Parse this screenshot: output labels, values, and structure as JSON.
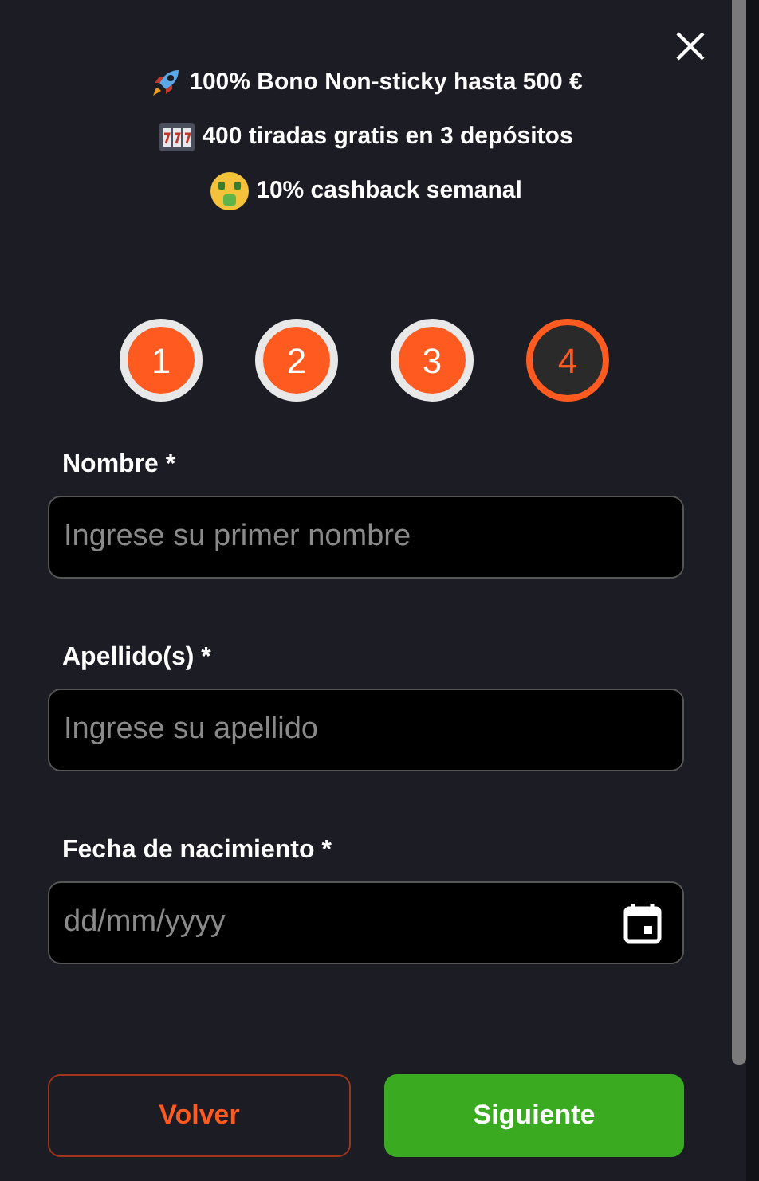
{
  "promos": [
    {
      "kind": "rocket",
      "text": "100% Bono Non-sticky hasta 500 €"
    },
    {
      "kind": "slots",
      "text": "400 tiradas gratis en 3 depósitos"
    },
    {
      "kind": "money",
      "text": "10% cashback semanal"
    }
  ],
  "steps": [
    {
      "label": "1",
      "completed": true
    },
    {
      "label": "2",
      "completed": true
    },
    {
      "label": "3",
      "completed": true
    },
    {
      "label": "4",
      "completed": false
    }
  ],
  "fields": [
    {
      "kind": "text",
      "label": "Nombre *",
      "placeholder": "Ingrese su primer nombre"
    },
    {
      "kind": "text",
      "label": "Apellido(s) *",
      "placeholder": "Ingrese su apellido"
    },
    {
      "kind": "date",
      "label": "Fecha de nacimiento *",
      "placeholder": "dd/mm/yyyy"
    }
  ],
  "buttons": {
    "back": "Volver",
    "next": "Siguiente"
  }
}
